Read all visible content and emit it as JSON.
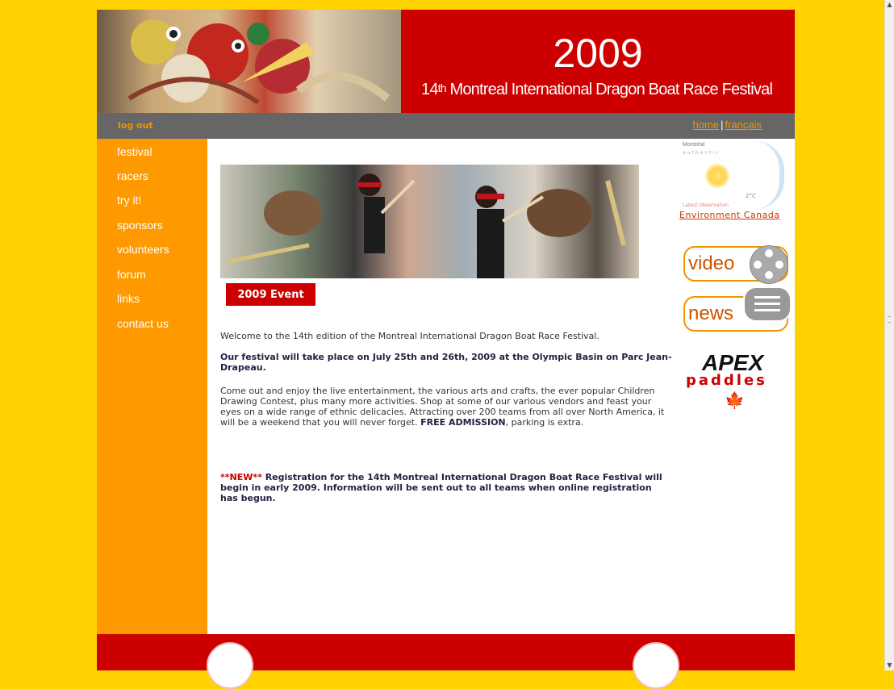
{
  "banner": {
    "year": "2009",
    "title_ordinal": "14",
    "title_suffix": "th",
    "title_rest": " Montreal International Dragon Boat Race Festival"
  },
  "topbar": {
    "logout": "log out",
    "home": "home",
    "separator": "|",
    "french": "français"
  },
  "nav": {
    "items": [
      "festival",
      "racers",
      "try it!",
      "sponsors",
      "volunteers",
      "forum",
      "links",
      "contact us"
    ]
  },
  "main": {
    "badge": "2009 Event",
    "welcome": "Welcome to the 14th edition of the Montreal International Dragon Boat Race Festival.",
    "dates": "Our festival will take place on July 25th and 26th, 2009 at the Olympic Basin on Parc Jean-Drapeau.",
    "description_start": "Come out and enjoy the live entertainment, the various arts and crafts, the ever popular Children Drawing Contest, plus many more activities. Shop at some of our various vendors and feast your eyes on a wide range of ethnic delicacies. Attracting over 200 teams from all over North America, it will be a weekend that you will never forget. ",
    "free_admission": "FREE ADMISSION",
    "description_end": ", parking is extra.",
    "new_tag": "**NEW**",
    "registration": " Registration for the 14th Montreal International Dragon Boat Race Festival will begin in early 2009. Information will be sent out to all teams when online registration has begun."
  },
  "sidebar": {
    "weather_city": "Montréal",
    "weather_sub": "authentic",
    "weather_temp": "2°C",
    "weather_latest": "Latest Observation",
    "env_link": "Environment Canada",
    "video": "video",
    "news": "news",
    "apex": "APEX",
    "apex_sub": "paddles",
    "maple_leaf": "🍁"
  },
  "colors": {
    "page_bg": "#ffd200",
    "nav_orange": "#ff9900",
    "banner_red": "#cc0000",
    "grey_bar": "#666666",
    "link_orange": "#f39300"
  }
}
